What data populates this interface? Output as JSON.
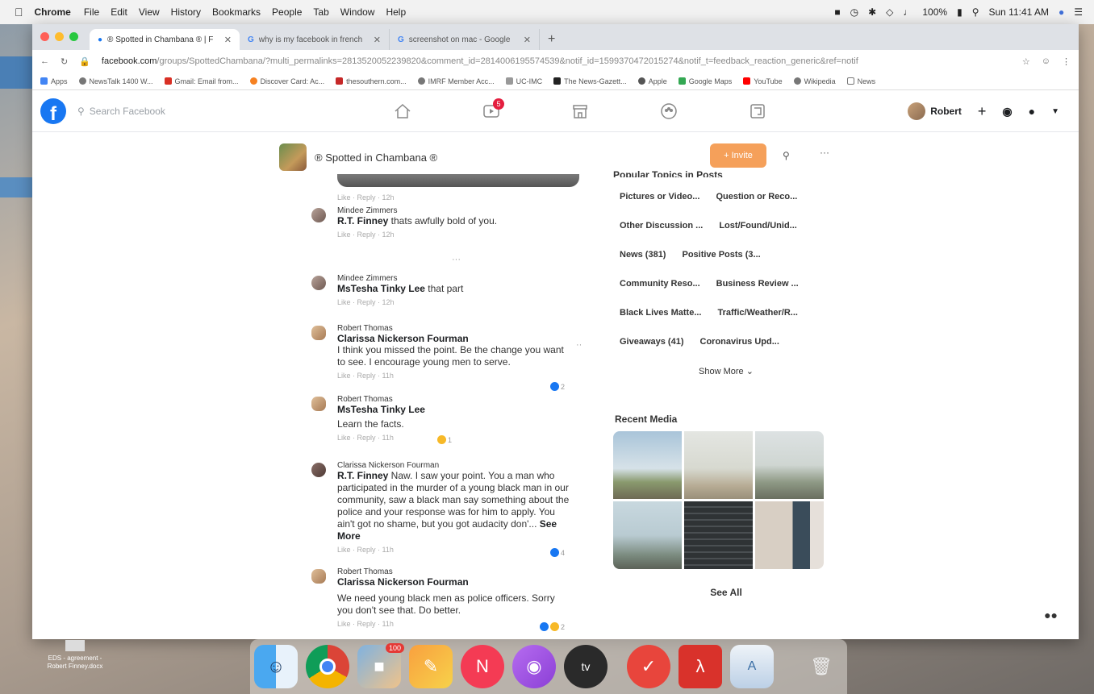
{
  "menubar": {
    "apple": "",
    "app": "Chrome",
    "items": [
      "File",
      "Edit",
      "View",
      "History",
      "Bookmarks",
      "People",
      "Tab",
      "Window",
      "Help"
    ],
    "battery": "100%",
    "clock": "Sun 11:41 AM"
  },
  "tabs": [
    {
      "title": "® Spotted in Chambana ® | F"
    },
    {
      "title": "why is my facebook in french"
    },
    {
      "title": "screenshot on mac - Google"
    }
  ],
  "address": {
    "domain": "facebook.com",
    "path": "/groups/SpottedChambana/?multi_permalinks=2813520052239820&comment_id=2814006195574539&notif_id=1599370472015274&notif_t=feedback_reaction_generic&ref=notif"
  },
  "bookmarks": [
    "Apps",
    "NewsTalk 1400 W...",
    "Gmail: Email from...",
    "Discover Card: Ac...",
    "thesouthern.com...",
    "IMRF Member Acc...",
    "UC-IMC",
    "The News-Gazett...",
    "Apple",
    "Google Maps",
    "YouTube",
    "Wikipedia",
    "News"
  ],
  "fb": {
    "search_placeholder": "Search Facebook",
    "watch_badge": "5",
    "user": "Robert"
  },
  "group": {
    "name": "® Spotted in Chambana ®",
    "invite": "+ Invite"
  },
  "comments": [
    {
      "meta": "Like · Reply · 12h"
    },
    {
      "author": "Mindee Zimmers",
      "mention": "R.T. Finney",
      "text": " thats awfully bold of you.",
      "meta": "Like · Reply · 12h"
    },
    {
      "author": "Mindee Zimmers",
      "mention": "MsTesha Tinky Lee",
      "text": " that part",
      "meta": "Like · Reply · 12h"
    },
    {
      "author": "Robert Thomas",
      "mention": "Clarissa Nickerson Fourman",
      "text": "I think you missed the point. Be the change you want to see. I encourage young men to serve.",
      "meta": "Like · Reply · 11h",
      "reactions": "2"
    },
    {
      "author": "Robert Thomas",
      "mention": "MsTesha Tinky Lee",
      "text": "Learn the facts.",
      "meta": "Like · Reply · 11h",
      "reactions": "1"
    },
    {
      "author": "Clarissa Nickerson Fourman",
      "mention": "R.T. Finney",
      "text": " Naw. I saw your point. You a man who participated in the murder of a young black man in our community, saw a black man say something about the police and your response was for him to apply. You ain't got no shame, but you got audacity don'...",
      "see_more": " See More",
      "meta": "Like · Reply · 11h",
      "reactions": "4"
    },
    {
      "author": "Robert Thomas",
      "mention": "Clarissa Nickerson Fourman",
      "text": "We need young black men as police officers. Sorry you don't see that. Do better.",
      "meta": "Like · Reply · 11h",
      "reactions": "2"
    }
  ],
  "sidebar": {
    "popular_title": "Popular Topics in Posts",
    "topics": [
      "Pictures or Video...",
      "Question or Reco...",
      "Other Discussion ...",
      "Lost/Found/Unid...",
      "News (381)",
      "Positive Posts (3...",
      "Community Reso...",
      "Business Review ...",
      "Black Lives Matte...",
      "Traffic/Weather/R...",
      "Giveaways (41)",
      "Coronavirus Upd..."
    ],
    "show_more": "Show More",
    "recent_media_title": "Recent Media",
    "see_all": "See All"
  },
  "desktop": {
    "file": "EDS - agreement - Robert Finney.docx"
  },
  "dock": {
    "photos_badge": "100"
  },
  "colors": {
    "facebook_blue": "#1877f2",
    "invite_orange": "#f5a05a",
    "badge_red": "#e41e3f"
  }
}
